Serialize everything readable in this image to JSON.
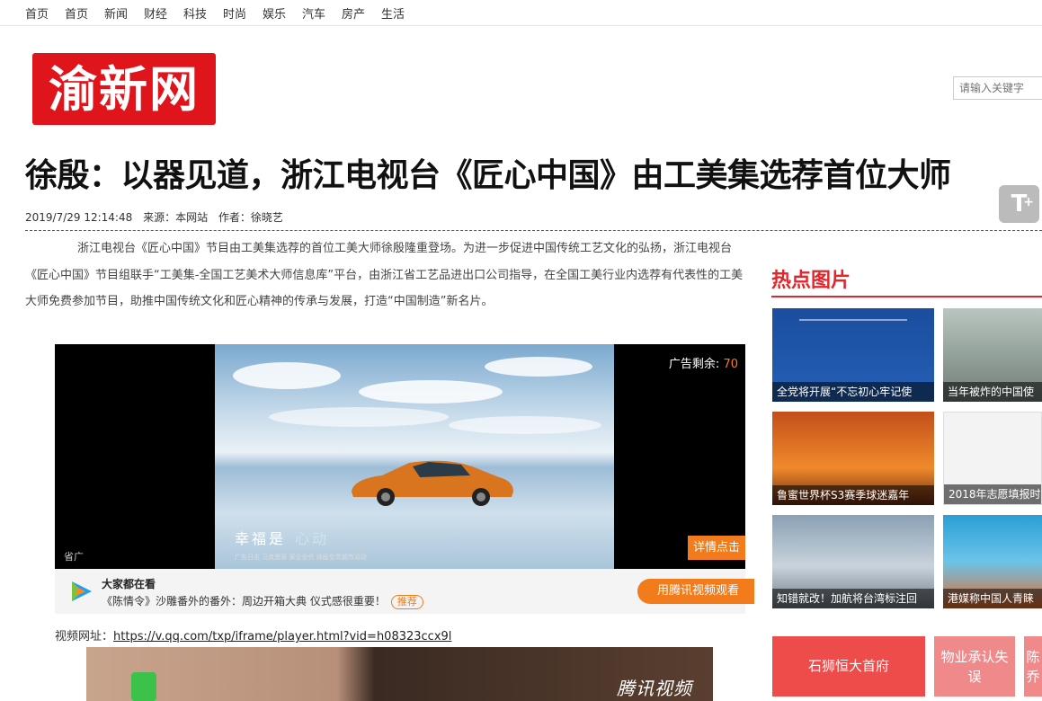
{
  "nav": [
    "首页",
    "首页",
    "新闻",
    "财经",
    "科技",
    "时尚",
    "娱乐",
    "汽车",
    "房产",
    "生活"
  ],
  "logo_text": "渝新网",
  "search": {
    "placeholder": "请输入关键字"
  },
  "article": {
    "title": "徐殷：以器见道，浙江电视台《匠心中国》由工美集选荐首位大师",
    "date": "2019/7/29 12:14:48",
    "source": "来源：本网站",
    "author": "作者：徐晓艺",
    "paragraph": "浙江电视台《匠心中国》节目由工美集选荐的首位工美大师徐殷隆重登场。为进一步促进中国传统工艺文化的弘扬，浙江电视台《匠心中国》节目组联手“工美集-全国工艺美术大师信息库”平台，由浙江省工艺品进出口公司指导，在全国工美行业内选荐有代表性的工美大师免费参加节目，助推中国传统文化和匠心精神的传承与发展，打造“中国制造”新名片。"
  },
  "font_button": {
    "main": "T",
    "sub": "+"
  },
  "video": {
    "ad_remaining_label": "广告剩余:",
    "ad_remaining_value": "70",
    "slogan": "幸福是",
    "slogan_accent": "心动",
    "fine_print": "广告日志  马克思家  家企业代  诗画空灵城市活动",
    "ad_tag": "省广",
    "details_button": "详情点击",
    "bar_title": "大家都在看",
    "bar_sub": "《陈情令》沙雕番外的番外：周边开箱大典 仪式感很重要！",
    "recommend_badge": "推荐",
    "watch_button": "用腾讯视频观看",
    "url_label": "视频网址：",
    "url": "https://v.qq.com/txp/iframe/player.html?vid=h08323ccx9l",
    "brand": "腾讯视频"
  },
  "hot": {
    "title": "热点图片",
    "items": [
      {
        "caption": "全党将开展“不忘初心牢记使"
      },
      {
        "caption": "当年被炸的中国使"
      },
      {
        "caption": "鲁蜜世界杯S3赛季球迷嘉年"
      },
      {
        "caption": "2018年志愿填报时"
      },
      {
        "caption": "知错就改！加航将台湾标注回"
      },
      {
        "caption": "港媒称中国人青睐"
      }
    ]
  },
  "tags": [
    "石狮恒大首府",
    "物业承认失误",
    "陈乔"
  ],
  "colors": {
    "brand_red": "#e0151c",
    "accent_orange": "#f27b1b",
    "hot_red": "#e0262b"
  }
}
